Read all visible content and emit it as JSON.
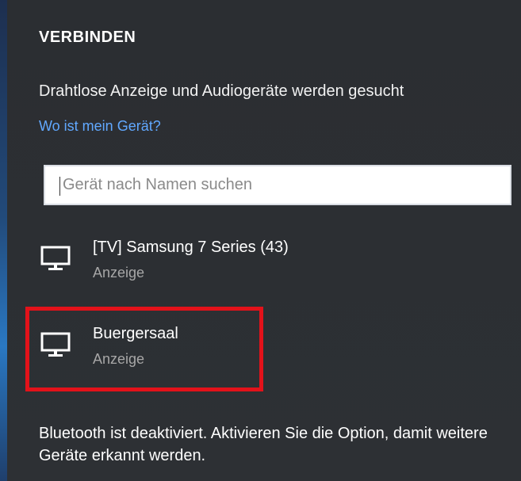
{
  "left_edge": {
    "colors": [
      "#1d2f4f",
      "#224a7a",
      "#2a78c2",
      "#1f3f6c"
    ]
  },
  "panel": {
    "title": "VERBINDEN",
    "status_text": "Drahtlose Anzeige und Audiogeräte werden gesucht",
    "help_link": "Wo ist mein Gerät?",
    "search": {
      "placeholder": "Gerät nach Namen suchen",
      "value": ""
    },
    "devices": [
      {
        "name": "[TV] Samsung 7 Series (43)",
        "type": "Anzeige",
        "icon": "monitor-icon",
        "highlighted": false
      },
      {
        "name": "Buergersaal",
        "type": "Anzeige",
        "icon": "monitor-icon",
        "highlighted": true
      }
    ],
    "bluetooth_status": "Bluetooth ist deaktiviert. Aktivieren Sie die Option, damit weitere Geräte erkannt werden."
  },
  "colors": {
    "background": "#2c2f33",
    "text": "#ffffff",
    "link": "#61a8ff",
    "secondary_text": "#a7a7a7",
    "highlight": "#e3121a"
  }
}
